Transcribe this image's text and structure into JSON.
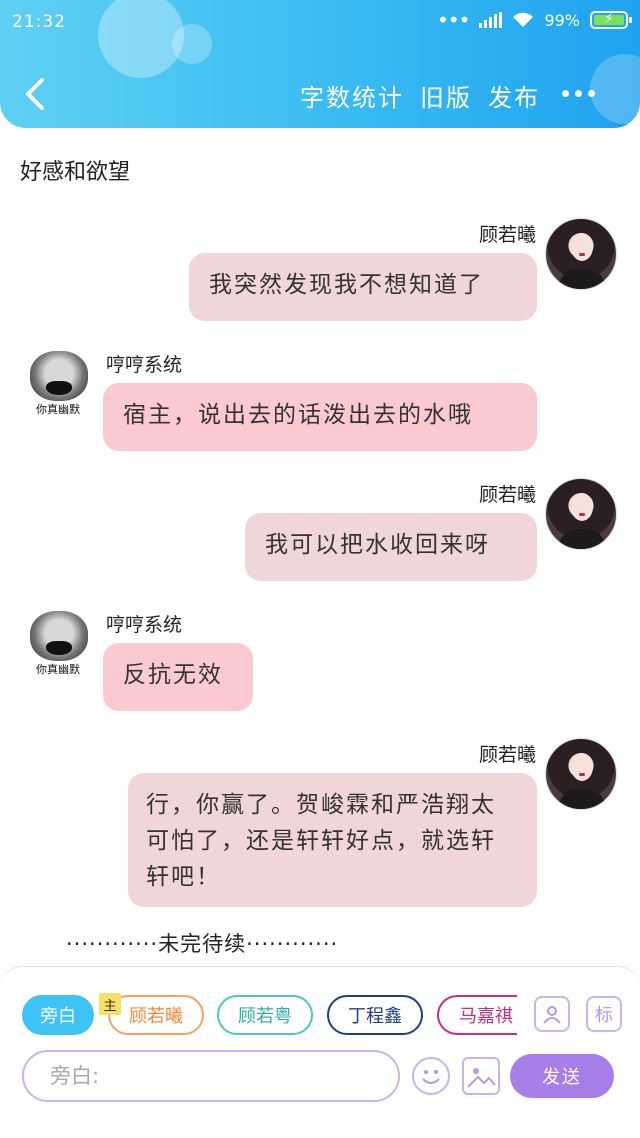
{
  "status_bar": {
    "time": "21:32",
    "battery": "99%"
  },
  "header": {
    "nav_wordcount": "字数统计",
    "nav_old": "旧版",
    "nav_publish": "发布"
  },
  "story": {
    "title": "好感和欲望",
    "to_be_continued": "············未完待续············"
  },
  "messages": [
    {
      "speaker": "顾若曦",
      "side": "right",
      "text": "我突然发现我不想知道了"
    },
    {
      "speaker": "哼哼系统",
      "side": "left",
      "text": "宿主，说出去的话泼出去的水哦",
      "avatar_caption": "你真幽默"
    },
    {
      "speaker": "顾若曦",
      "side": "right",
      "text": "我可以把水收回来呀"
    },
    {
      "speaker": "哼哼系统",
      "side": "left",
      "text": "反抗无效",
      "avatar_caption": "你真幽默"
    },
    {
      "speaker": "顾若曦",
      "side": "right",
      "text": "行，你赢了。贺峻霖和严浩翔太可怕了，还是轩轩好点，就选轩轩吧！"
    }
  ],
  "bottom": {
    "chips": [
      "旁白",
      "顾若曦",
      "顾若粤",
      "丁程鑫",
      "马嘉祺"
    ],
    "tag_hint": "主",
    "icon_tag_label": "标",
    "input_placeholder": "旁白:",
    "send_label": "发送"
  },
  "colors": {
    "header_gradient_start": "#5fd0f3",
    "header_gradient_end": "#1fa2f0",
    "right_bubble": "#f0d5d9",
    "left_bubble": "#fbc9d0",
    "send_button": "#a77ee8",
    "accent_purple": "#c9b4ee"
  },
  "icons": [
    "back-arrow-icon",
    "more-dots-icon",
    "signal-icon",
    "wifi-icon",
    "battery-icon",
    "person-card-icon",
    "emoji-icon",
    "image-icon"
  ]
}
